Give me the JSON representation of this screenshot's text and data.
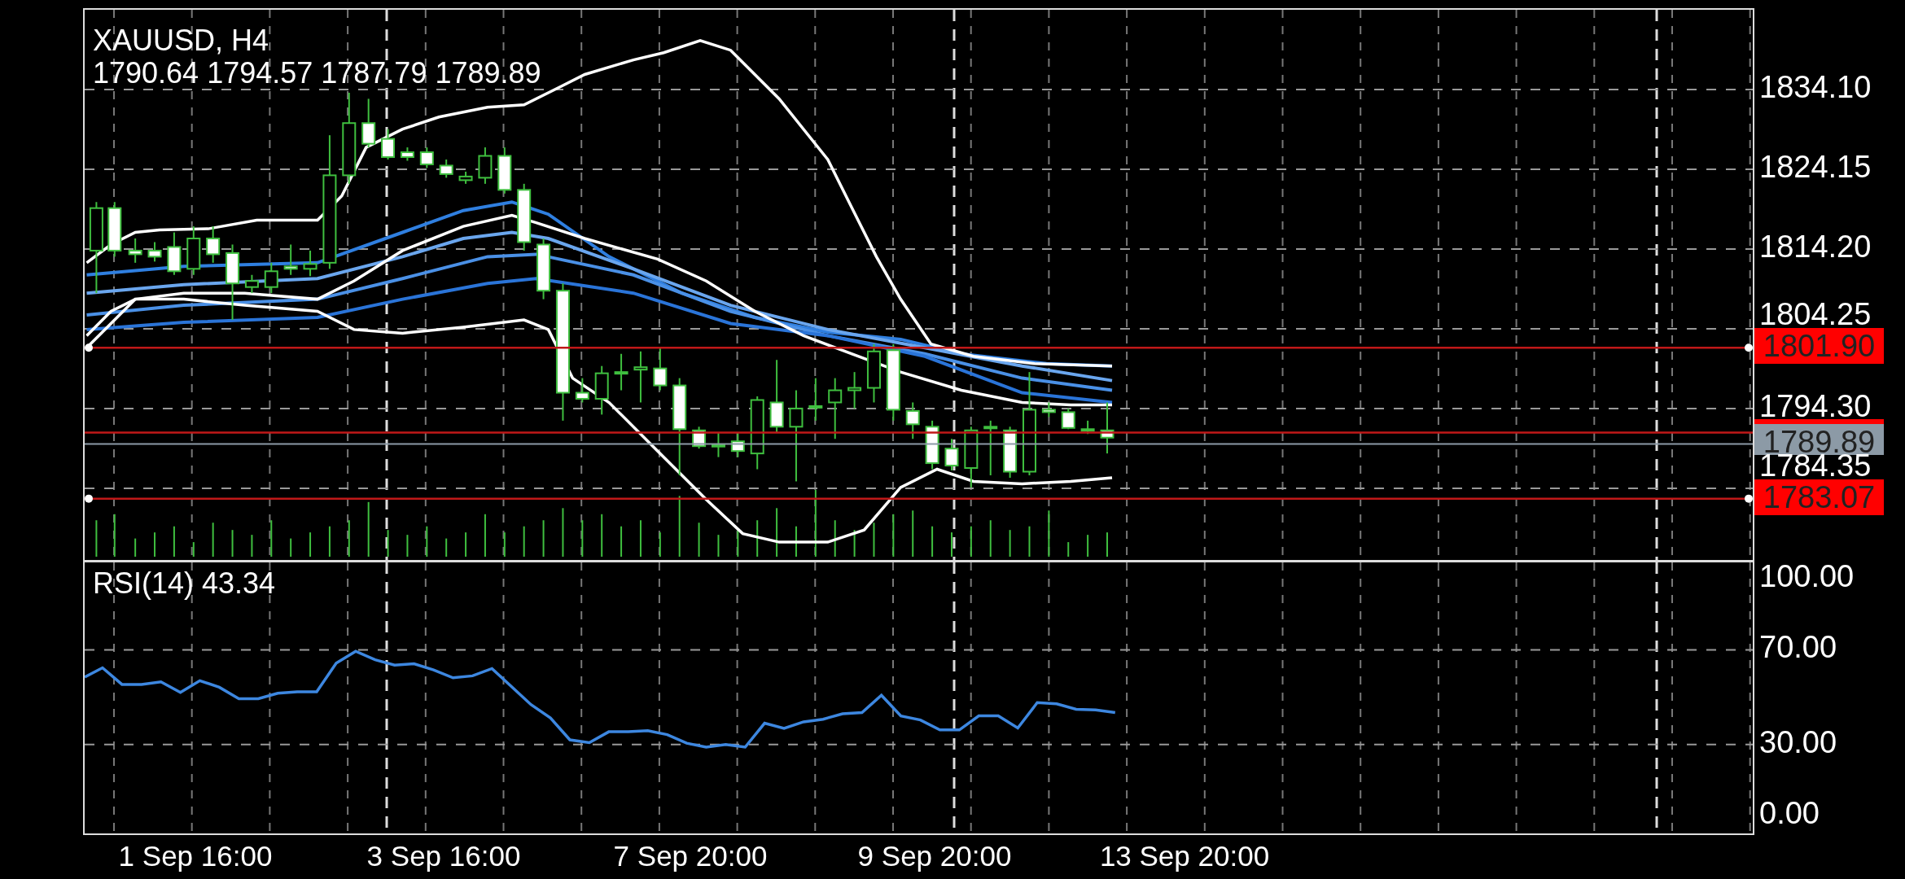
{
  "chart": {
    "symbol": "XAUUSD, H4",
    "ohlc": "1790.64 1794.57 1787.79 1789.89"
  },
  "price_axis": {
    "labels": [
      "1834.10",
      "1824.15",
      "1814.20",
      "1804.25",
      "1794.30",
      "1784.35"
    ]
  },
  "price_lines": [
    {
      "price": "1801.90",
      "kind": "level"
    },
    {
      "price": "1789.89",
      "kind": "bid"
    },
    {
      "price": "1783.07",
      "kind": "level"
    }
  ],
  "rsi_panel": {
    "chart_data": {
      "type": "line",
      "grid": true,
      "title": "RSI(14) 43.34",
      "ylim": [
        -7.5,
        106.9
      ],
      "yticks": [
        {
          "value": 100,
          "label": "100.00"
        },
        {
          "value": 70,
          "label": "70.00"
        },
        {
          "value": 30,
          "label": "30.00"
        },
        {
          "value": 0,
          "label": "0.00"
        }
      ],
      "series": [
        {
          "color": "#3d87e0",
          "values": [
            58.5,
            62.4,
            55.4,
            55.4,
            56.5,
            52,
            57,
            54.2,
            49.4,
            49.4,
            51.7,
            52.3,
            52.3,
            64.4,
            69.4,
            65.8,
            63.5,
            64.1,
            61.5,
            58.2,
            59,
            62.1,
            54.5,
            46.9,
            41.3,
            32,
            30.8,
            35.4,
            35.4,
            35.9,
            34.2,
            30.6,
            28.9,
            30,
            28.9,
            39,
            36.8,
            39.6,
            40.7,
            43,
            43.5,
            50.8,
            42.1,
            40.4,
            36.2,
            36.2,
            42.1,
            42.1,
            37,
            47.7,
            47.2,
            44.9,
            44.6,
            43.5
          ]
        }
      ]
    }
  },
  "time_axis": {
    "labels": [
      "1 Sep 16:00",
      "3 Sep 16:00",
      "7 Sep 20:00",
      "9 Sep 20:00",
      "13 Sep 20:00"
    ]
  }
}
